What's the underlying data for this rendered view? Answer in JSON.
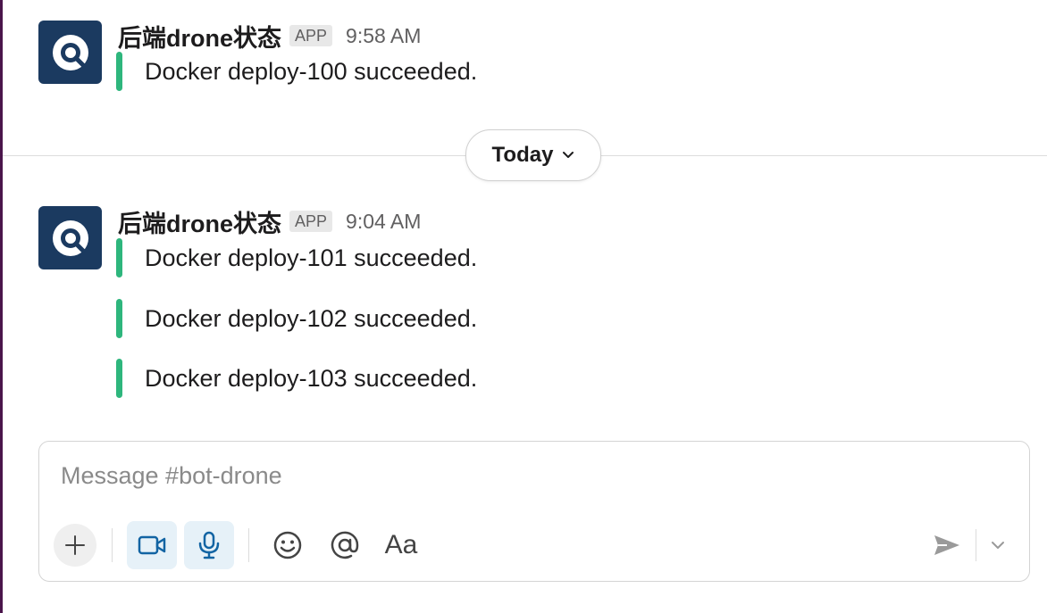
{
  "messages": [
    {
      "sender": "后端drone状态",
      "badge": "APP",
      "time": "9:58 AM",
      "attachments": [
        "Docker deploy-100 succeeded."
      ]
    },
    {
      "sender": "后端drone状态",
      "badge": "APP",
      "time": "9:04 AM",
      "attachments": [
        "Docker deploy-101 succeeded.",
        "Docker deploy-102 succeeded.",
        "Docker deploy-103 succeeded."
      ]
    }
  ],
  "day_divider": {
    "label": "Today"
  },
  "composer": {
    "placeholder": "Message #bot-drone",
    "format_label": "Aa"
  },
  "icons": {
    "avatar": "drone-logo-icon",
    "divider_chevron": "chevron-down-icon",
    "plus": "plus-icon",
    "video": "video-icon",
    "mic": "microphone-icon",
    "emoji": "emoji-icon",
    "mention": "mention-icon",
    "send": "send-icon",
    "send_options": "chevron-down-icon"
  },
  "colors": {
    "avatar_bg": "#1b3a60",
    "attachment_bar": "#2eb67d",
    "sidebar_edge": "#4a154b"
  }
}
